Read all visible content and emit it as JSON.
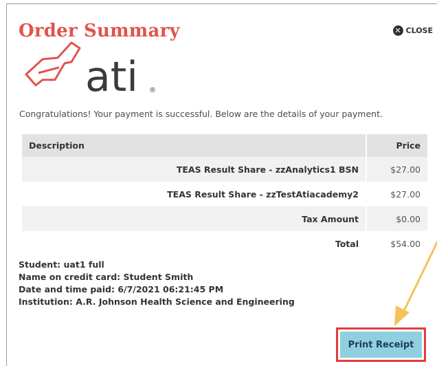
{
  "header": {
    "title": "Order Summary",
    "close_label": "CLOSE"
  },
  "logo": {
    "text": "ati",
    "trademark": "®"
  },
  "intro_text": "Congratulations! Your payment is successful. Below are the details of your payment.",
  "table": {
    "headers": {
      "description": "Description",
      "price": "Price"
    },
    "rows": [
      {
        "description": "TEAS Result Share - zzAnalytics1 BSN",
        "price": "$27.00"
      },
      {
        "description": "TEAS Result Share - zzTestAtiacademy2",
        "price": "$27.00"
      },
      {
        "description": "Tax Amount",
        "price": "$0.00"
      },
      {
        "description": "Total",
        "price": "$54.00"
      }
    ]
  },
  "details": [
    "Student: uat1 full",
    "Name on credit card: Student Smith",
    "Date and time paid: 6/7/2021 06:21:45 PM",
    "Institution: A.R. Johnson Health Science and Engineering"
  ],
  "print_button_label": "Print Receipt",
  "colors": {
    "title": "#e1534c",
    "highlight_border": "#e63b3b",
    "print_button": "#8fd0e0",
    "arrow": "#f5c15a"
  }
}
